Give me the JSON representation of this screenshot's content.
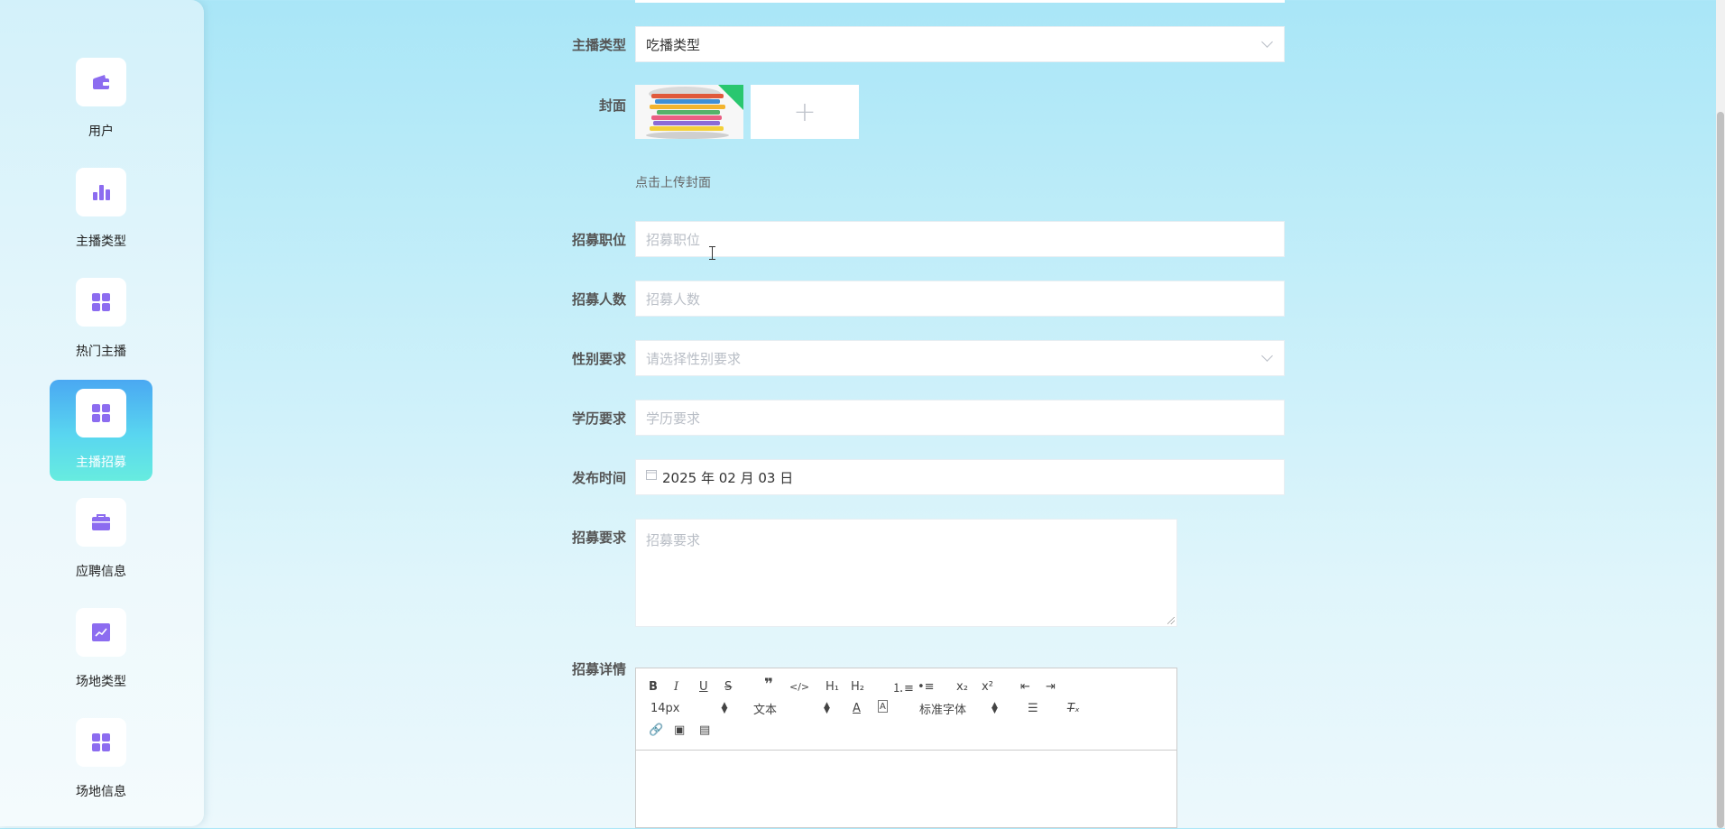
{
  "sidebar": {
    "items": [
      {
        "label": "用户",
        "icon": "wallet-icon",
        "active": false
      },
      {
        "label": "主播类型",
        "icon": "bar-chart-icon",
        "active": false
      },
      {
        "label": "热门主播",
        "icon": "grid-icon",
        "active": false
      },
      {
        "label": "主播招募",
        "icon": "grid-icon",
        "active": true
      },
      {
        "label": "应聘信息",
        "icon": "briefcase-icon",
        "active": false
      },
      {
        "label": "场地类型",
        "icon": "line-chart-icon",
        "active": false
      },
      {
        "label": "场地信息",
        "icon": "grid-icon",
        "active": false
      }
    ]
  },
  "form": {
    "anchor_type": {
      "label": "主播类型",
      "value": "吃播类型"
    },
    "cover": {
      "label": "封面",
      "hint": "点击上传封面",
      "add_symbol": "+"
    },
    "position": {
      "label": "招募职位",
      "placeholder": "招募职位"
    },
    "headcount": {
      "label": "招募人数",
      "placeholder": "招募人数"
    },
    "gender": {
      "label": "性别要求",
      "placeholder": "请选择性别要求"
    },
    "education": {
      "label": "学历要求",
      "placeholder": "学历要求"
    },
    "publish_time": {
      "label": "发布时间",
      "value": "2025 年 02 月 03 日"
    },
    "requirements": {
      "label": "招募要求",
      "placeholder": "招募要求"
    },
    "details": {
      "label": "招募详情",
      "toolbar": {
        "font_size": "14px",
        "paragraph": "文本",
        "font_family": "标准字体"
      }
    }
  },
  "colors": {
    "accent_icon": "#8c6cf0",
    "active_nav_top": "#4aa8f2",
    "active_nav_bottom": "#67ecdf",
    "cover_corner": "#29c76f"
  }
}
